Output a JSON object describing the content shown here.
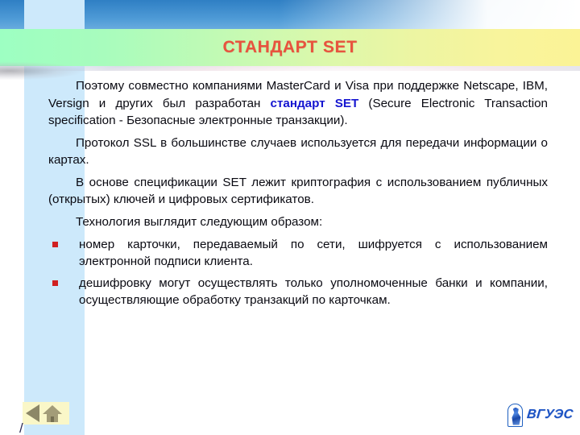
{
  "slide": {
    "title": "СТАНДАРТ SET",
    "title_color": "#e8533e",
    "band_color_left": "#9dffc2",
    "band_color_right": "#fbf396",
    "sidebar_color": "#cde9fb",
    "keyword_color": "#1515d0",
    "bullet_color": "#d02020"
  },
  "paragraphs": [
    {
      "pre": "Поэтому совместно компаниями MasterCard и Visa при поддержке Netscape, IBM, Versign и других был разработан ",
      "keyword": "стандарт SET",
      "post": " (Secure Electronic Transaction specification - Безопасные электронные транзакции)."
    },
    {
      "pre": "Протокол SSL в большинстве случаев используется для передачи информации о картах.",
      "keyword": "",
      "post": ""
    },
    {
      "pre": "В основе спецификации SET лежит криптография с использованием публичных (открытых) ключей и цифровых сертификатов.",
      "keyword": "",
      "post": ""
    },
    {
      "pre": "Технология выглядит следующим образом:",
      "keyword": "",
      "post": ""
    }
  ],
  "bullets": [
    {
      "text": "номер карточки, передаваемый по сети, шифруется с использованием электронной подписи клиента."
    },
    {
      "text": "дешифровку могут осуществлять только уполномоченные банки и компании, осуществляющие обработку транзакций по карточкам."
    }
  ],
  "navigation": {
    "back_label": "",
    "home_label": "",
    "squiggle": "/"
  },
  "logo": {
    "word": "ВГУЭС",
    "color": "#1c53c4"
  }
}
